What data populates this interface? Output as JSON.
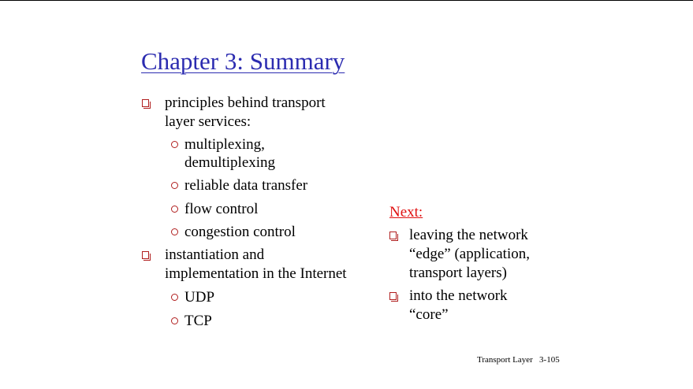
{
  "slide": {
    "title": "Chapter 3: Summary",
    "left_bullets": [
      {
        "lines": [
          "principles behind transport",
          "layer services:"
        ]
      },
      {
        "lines": [
          "instantiation and",
          "implementation in the Internet"
        ]
      }
    ],
    "sub_bullets_1": [
      {
        "lines": [
          "multiplexing,",
          "demultiplexing"
        ]
      },
      {
        "lines": [
          "reliable data transfer"
        ]
      },
      {
        "lines": [
          "flow control"
        ]
      },
      {
        "lines": [
          "congestion control"
        ]
      }
    ],
    "sub_bullets_2": [
      {
        "lines": [
          "UDP"
        ]
      },
      {
        "lines": [
          "TCP"
        ]
      }
    ],
    "next": {
      "label": "Next:",
      "bullets": [
        {
          "lines": [
            "leaving the network",
            "“edge” (application,",
            "transport layers)"
          ]
        },
        {
          "lines": [
            "into the network",
            "“core”"
          ]
        }
      ]
    },
    "footer": {
      "section": "Transport Layer",
      "page": "3-105"
    }
  },
  "colors": {
    "title": "#2b2bb0",
    "bullet_marks": "#b01e1e",
    "next_label": "#e01010"
  }
}
